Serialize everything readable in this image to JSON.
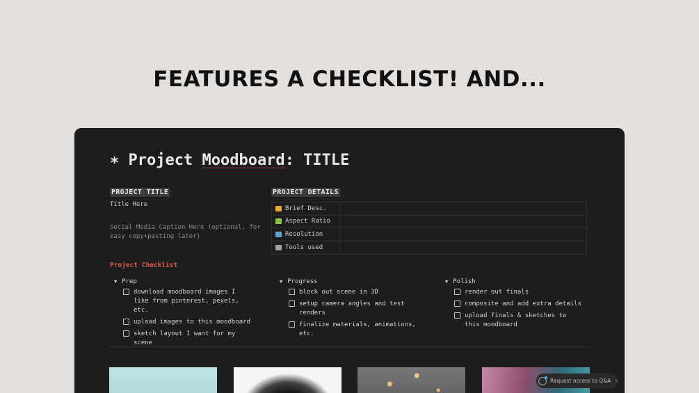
{
  "headline": "FEATURES A CHECKLIST! AND...",
  "page": {
    "title_icon": "∗",
    "title_pre": "Project ",
    "title_underlined": "Moodboard",
    "title_post": ": TITLE"
  },
  "project_title": {
    "label": "PROJECT TITLE",
    "value": "Title Here",
    "caption": "Social Media Caption Here (optional, for easy copy+pasting later)"
  },
  "project_details": {
    "label": "PROJECT DETAILS",
    "rows": [
      {
        "icon": "brief-icon",
        "color": "#e6a73b",
        "label": "Brief Desc."
      },
      {
        "icon": "aspect-ratio-icon",
        "color": "#8bc34a",
        "label": "Aspect Ratio"
      },
      {
        "icon": "ruler-icon",
        "color": "#5fa8d3",
        "label": "Resolution"
      },
      {
        "icon": "computer-icon",
        "color": "#9aa4ad",
        "label": "Tools used"
      }
    ]
  },
  "checklist": {
    "title": "Project Checklist",
    "title_color": "#e05a4e",
    "columns": [
      {
        "heading": "Prep",
        "items": [
          "download moodboard images I like from pinterest, pexels, etc.",
          "upload images to this moodboard",
          "sketch layout I want for my scene"
        ]
      },
      {
        "heading": "Progress",
        "items": [
          "block out scene in 3D",
          "setup camera angles and test renders",
          "finalize materials, animations, etc."
        ]
      },
      {
        "heading": "Polish",
        "items": [
          "render out finals",
          "composite and add extra details",
          "upload finals & sketches to this moodboard"
        ]
      }
    ]
  },
  "qa_button": {
    "label": "Request access to Q&A"
  }
}
